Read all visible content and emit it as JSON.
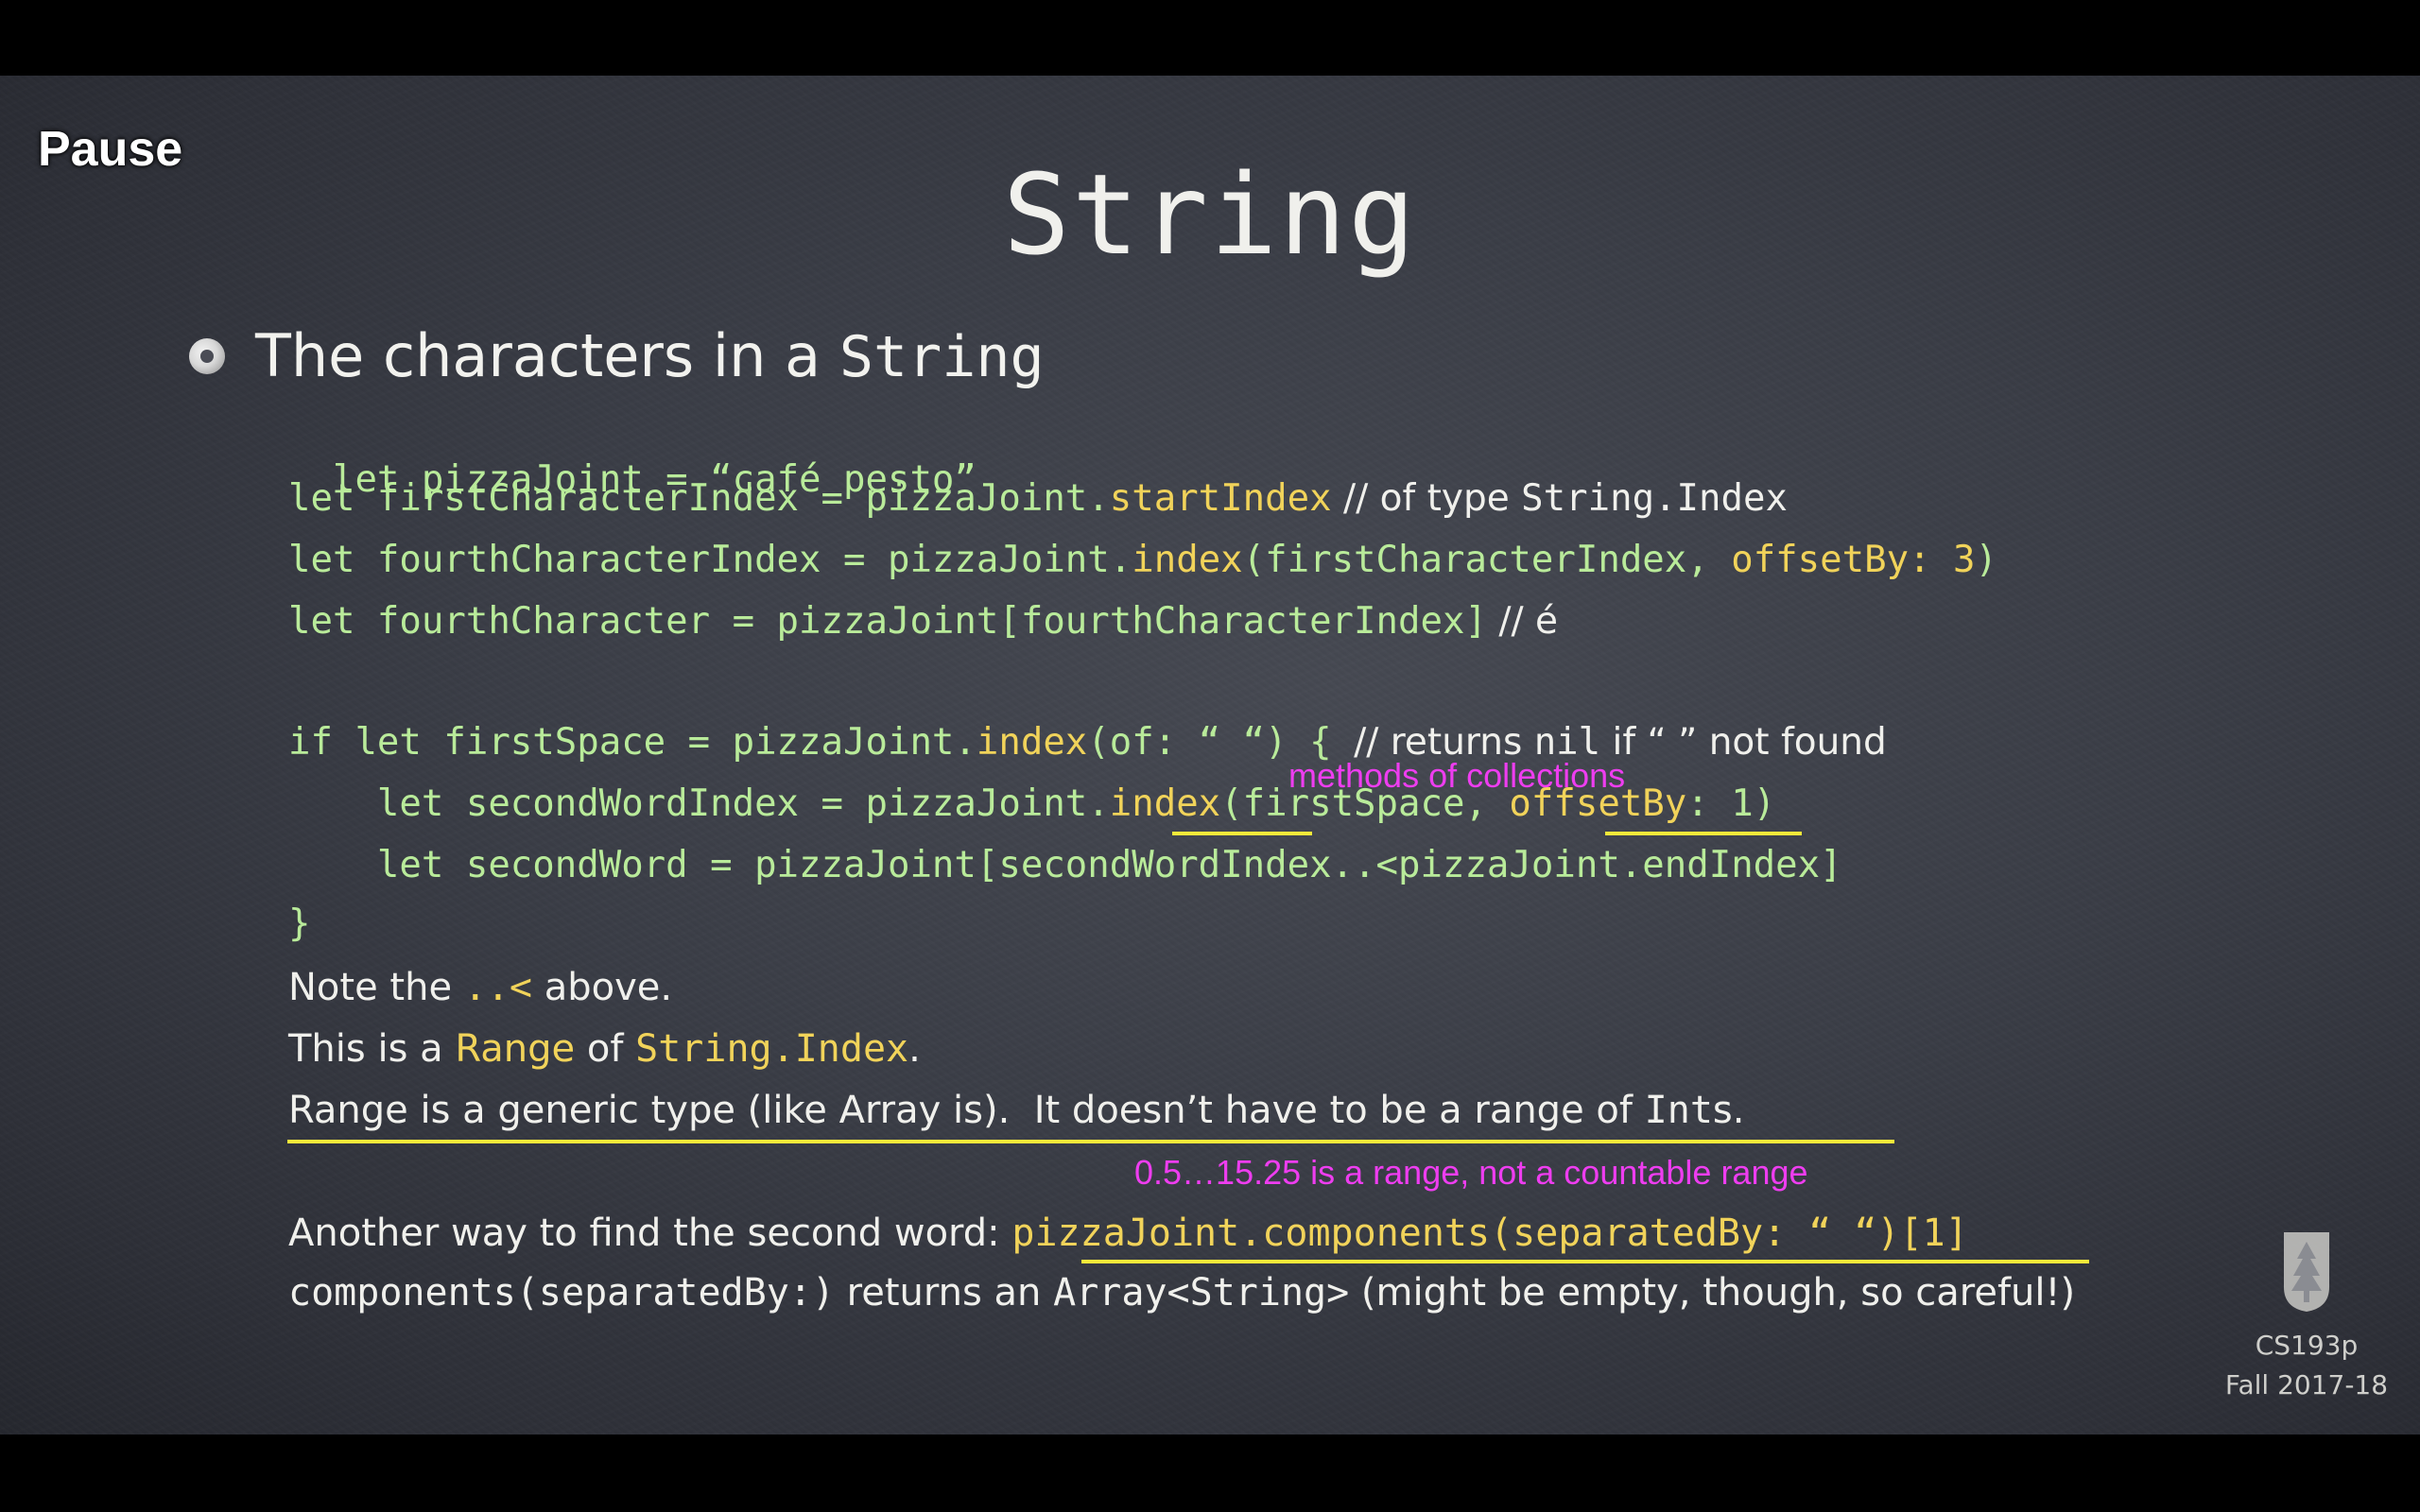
{
  "player": {
    "pause_label": "Pause"
  },
  "slide": {
    "title": "String",
    "bullet": {
      "text_before": "The characters in a ",
      "text_mono": "String"
    },
    "code": {
      "l1": {
        "a": "let pizzaJoint = “café pesto”"
      },
      "l2": {
        "a": "let firstCharacterIndex = pizzaJoint.",
        "b": "startIndex",
        "c": " // of type ",
        "d": "String.Index"
      },
      "l3": {
        "a": "let fourthCharacterIndex = pizzaJoint.",
        "b": "index",
        "c": "(firstCharacterIndex, ",
        "d": "offsetBy: 3",
        "e": ")"
      },
      "l4": {
        "a": "let fourthCharacter = pizzaJoint[fourthCharacterIndex]",
        "b": " // é"
      },
      "l5": {
        "a": "if let firstSpace = pizzaJoint.",
        "b": "index",
        "c": "(of: “ “) { ",
        "d": "// returns ",
        "e": "nil",
        "f": " if “ ” not found"
      },
      "l6": {
        "a": "    let secondWordIndex = pizzaJoint.",
        "b": "index",
        "c": "(firstSpace, ",
        "d": "offsetBy",
        "e": ": 1)"
      },
      "l7": {
        "a": "    let secondWord = pizzaJoint[secondWordIndex..<pizzaJoint.endIndex]"
      },
      "l8": {
        "a": "}"
      }
    },
    "prose": {
      "p1": {
        "a": "Note the ",
        "b": "..<",
        "c": " above."
      },
      "p2": {
        "a": "This is a ",
        "b": "Range",
        "c": " of ",
        "d": "String.Index",
        "e": "."
      },
      "p3": {
        "a": "Range is a generic type (like Array is).  It doesn’t have to be a range of ",
        "b": "Int",
        "c": "s."
      },
      "p4": {
        "a": "Another way to find the second word: ",
        "b": "pizzaJoint.components(separatedBy: “ “)[1]"
      },
      "p5": {
        "a": "components(separatedBy:)",
        "b": " returns an ",
        "c": "Array<String>",
        "d": " (might be empty, though, so careful!)"
      }
    },
    "annotations": {
      "methods": "methods of collections",
      "range_note": "0.5…15.25 is a range, not a countable range"
    },
    "footer": {
      "course": "CS193p",
      "term": "Fall 2017-18"
    }
  },
  "colors": {
    "code_green": "#b9eb9a",
    "code_yellow": "#f1d35a",
    "annotation_magenta": "#ee3df0",
    "underline_yellow": "#f7e93a"
  }
}
